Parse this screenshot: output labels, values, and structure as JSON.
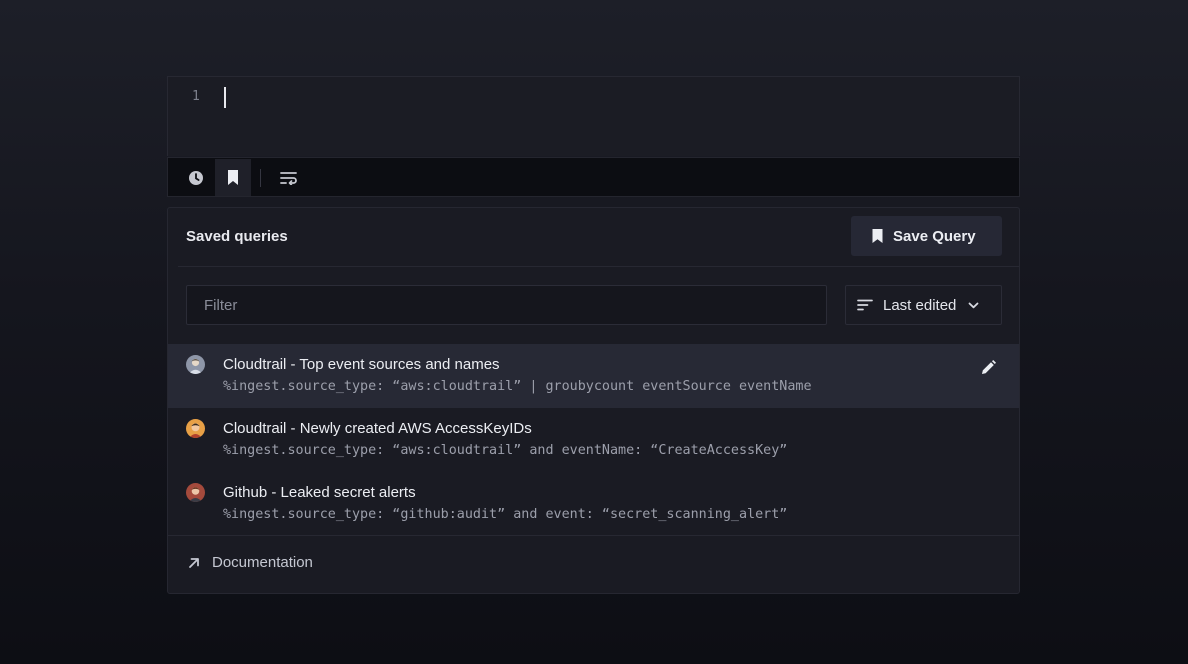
{
  "editor": {
    "line_number": "1"
  },
  "toolbar": {
    "buttons": [
      {
        "icon": "clock-icon",
        "active": false
      },
      {
        "icon": "bookmark-icon",
        "active": true
      },
      {
        "icon": "wrap-text-icon",
        "active": false
      }
    ]
  },
  "panel": {
    "title": "Saved queries",
    "save_button_label": "Save Query",
    "filter_placeholder": "Filter",
    "sort_label": "Last edited",
    "queries": [
      {
        "title": "Cloudtrail - Top event sources and names",
        "code": "%ingest.source_type: “aws:cloudtrail” | groubycount eventSource eventName",
        "avatar": "avatar-icon",
        "selected": true
      },
      {
        "title": "Cloudtrail - Newly created AWS AccessKeyIDs",
        "code": "%ingest.source_type: “aws:cloudtrail” and eventName: “CreateAccessKey”",
        "avatar": "avatar-icon",
        "selected": false
      },
      {
        "title": "Github - Leaked secret alerts",
        "code": "%ingest.source_type: “github:audit” and event: “secret_scanning_alert”",
        "avatar": "avatar-icon",
        "selected": false
      }
    ],
    "documentation_label": "Documentation"
  },
  "colors": {
    "panel_bg": "#1a1b23",
    "selected_row": "#272935",
    "toolbar_bg": "#0c0d12",
    "text_primary": "#eceef3",
    "text_code": "#9c9fab"
  }
}
